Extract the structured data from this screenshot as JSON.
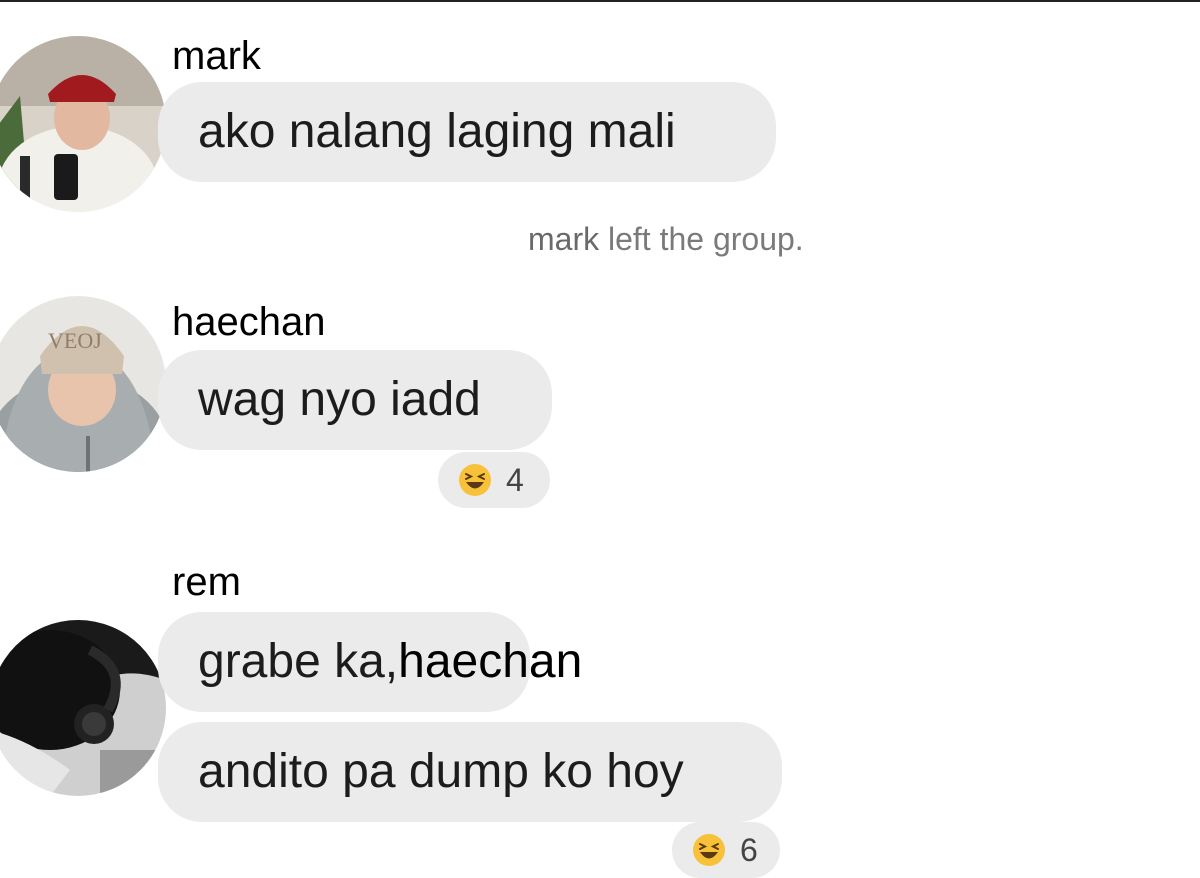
{
  "messages": [
    {
      "sender": "mark",
      "avatar": "mark-avatar",
      "bubbles": [
        {
          "text": "ako nalang laging mali"
        }
      ]
    },
    {
      "system": {
        "who": "mark",
        "rest": "left the group."
      }
    },
    {
      "sender": "haechan",
      "avatar": "haechan-avatar",
      "bubbles": [
        {
          "text": "wag nyo iadd"
        }
      ],
      "reaction": {
        "emoji": "laughing-face-icon",
        "count": "4"
      }
    },
    {
      "sender": "rem",
      "avatar": "rem-avatar",
      "bubbles": [
        {
          "text": "grabe ka,",
          "mention": "haechan"
        },
        {
          "text": "andito pa dump ko hoy"
        }
      ],
      "reaction": {
        "emoji": "laughing-face-icon",
        "count": "6"
      }
    }
  ],
  "colors": {
    "bubble": "#ebebeb",
    "system_text": "#7a7a7a",
    "emoji_yellow": "#f7c23a"
  }
}
